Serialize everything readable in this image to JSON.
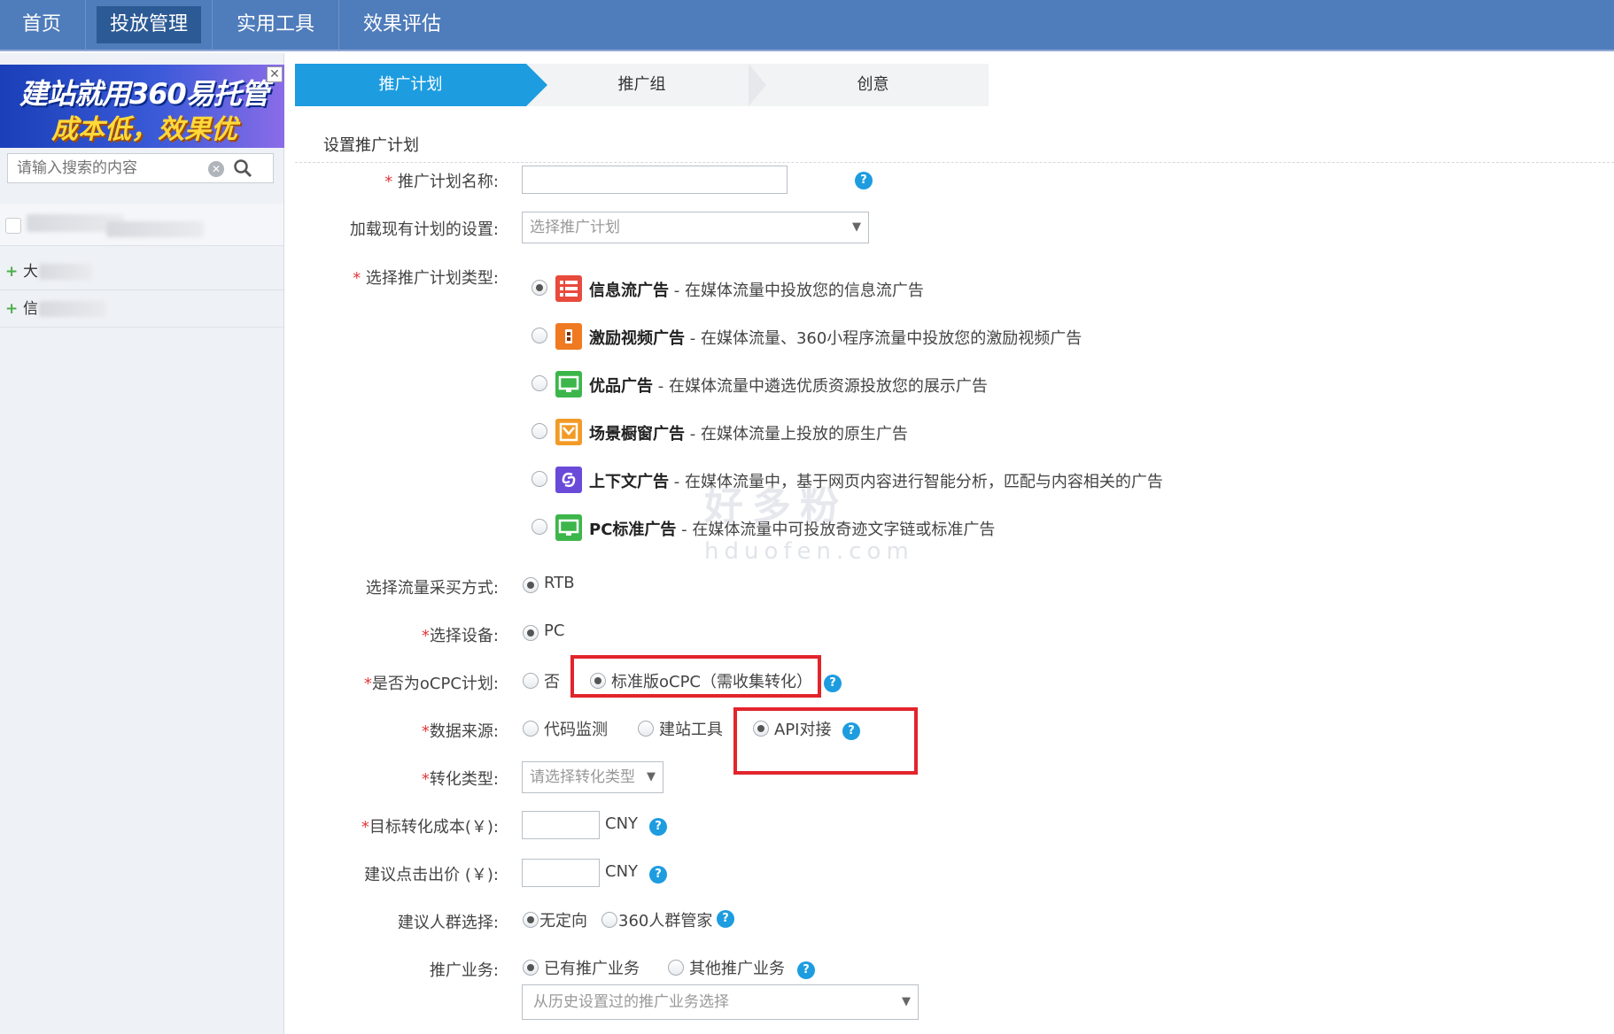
{
  "topnav": {
    "items": [
      "首页",
      "投放管理",
      "实用工具",
      "效果评估"
    ]
  },
  "sidebar": {
    "banner_line1": "建站就用360易托管",
    "banner_line2": "成本低，效果优",
    "banner_close": "✕",
    "search_placeholder": "请输入搜索的内容",
    "items": [
      {
        "plus": "+",
        "label": "大"
      },
      {
        "plus": "+",
        "label": "信"
      }
    ]
  },
  "steps": [
    "推广计划",
    "推广组",
    "创意"
  ],
  "section_title": "设置推广计划",
  "form": {
    "plan_name_label": "推广计划名称:",
    "load_label": "加载现有计划的设置:",
    "load_placeholder": "选择推广计划",
    "type_label": "选择推广计划类型:",
    "types": [
      {
        "name": "信息流广告",
        "desc": " - 在媒体流量中投放您的信息流广告",
        "icon": "feed-icon",
        "color": "#e84a3c"
      },
      {
        "name": "激励视频广告",
        "desc": " - 在媒体流量、360小程序流量中投放您的激励视频广告",
        "icon": "video-icon",
        "color": "#f07a22"
      },
      {
        "name": "优品广告",
        "desc": " - 在媒体流量中遴选优质资源投放您的展示广告",
        "icon": "monitor-icon",
        "color": "#3cb64a"
      },
      {
        "name": "场景橱窗广告",
        "desc": " - 在媒体流量上投放的原生广告",
        "icon": "window-icon",
        "color": "#f29a26"
      },
      {
        "name": "上下文广告",
        "desc": " - 在媒体流量中，基于网页内容进行智能分析，匹配与内容相关的广告",
        "icon": "context-icon",
        "color": "#6a4ad8"
      },
      {
        "name": "PC标准广告",
        "desc": " - 在媒体流量中可投放奇迹文字链或标准广告",
        "icon": "pc-icon",
        "color": "#3cb64a"
      }
    ],
    "traffic_label": "选择流量采买方式:",
    "traffic_value": "RTB",
    "device_label": "选择设备:",
    "device_value": "PC",
    "ocpc_label": "是否为oCPC计划:",
    "ocpc_no": "否",
    "ocpc_yes": "标准版oCPC（需收集转化）",
    "source_label": "数据来源:",
    "source_opts": [
      "代码监测",
      "建站工具",
      "API对接"
    ],
    "conv_type_label": "转化类型:",
    "conv_type_placeholder": "请选择转化类型",
    "target_cost_label": "目标转化成本(￥):",
    "suggest_bid_label": "建议点击出价 (￥):",
    "currency": "CNY",
    "crowd_label": "建议人群选择:",
    "crowd_opts": [
      "无定向",
      "360人群管家"
    ],
    "biz_label": "推广业务:",
    "biz_opts": [
      "已有推广业务",
      "其他推广业务"
    ],
    "biz_select_placeholder": "从历史设置过的推广业务选择",
    "required_mark": "*",
    "help": "?"
  },
  "watermark": {
    "line1": "好多粉",
    "line2": "hduofen.com"
  }
}
